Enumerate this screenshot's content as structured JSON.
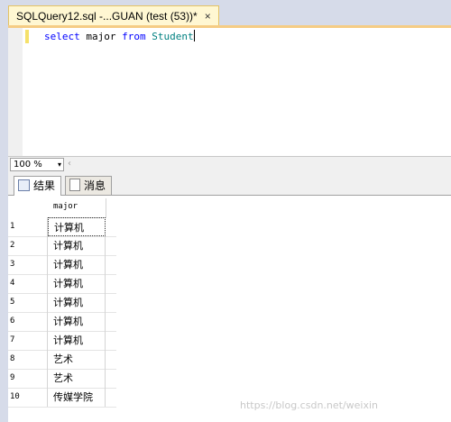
{
  "tab": {
    "title": "SQLQuery12.sql -...GUAN (test (53))*",
    "close_icon": "close-icon"
  },
  "editor": {
    "tokens": [
      {
        "text": "select",
        "kind": "kw"
      },
      {
        "text": " major ",
        "kind": "tx"
      },
      {
        "text": "from",
        "kind": "kw"
      },
      {
        "text": " ",
        "kind": "tx"
      },
      {
        "text": "Student",
        "kind": "ob"
      }
    ]
  },
  "zoom": {
    "value": "100 %",
    "arrow": "▾"
  },
  "results_tabs": [
    {
      "label": "结果",
      "icon": "grid-icon"
    },
    {
      "label": "消息",
      "icon": "message-icon"
    }
  ],
  "grid": {
    "column_header": "major",
    "rows": [
      {
        "n": "1",
        "major": "计算机"
      },
      {
        "n": "2",
        "major": "计算机"
      },
      {
        "n": "3",
        "major": "计算机"
      },
      {
        "n": "4",
        "major": "计算机"
      },
      {
        "n": "5",
        "major": "计算机"
      },
      {
        "n": "6",
        "major": "计算机"
      },
      {
        "n": "7",
        "major": "计算机"
      },
      {
        "n": "8",
        "major": "艺术"
      },
      {
        "n": "9",
        "major": "艺术"
      },
      {
        "n": "10",
        "major": "传媒学院"
      }
    ]
  },
  "watermark": "https://blog.csdn.net/weixin"
}
